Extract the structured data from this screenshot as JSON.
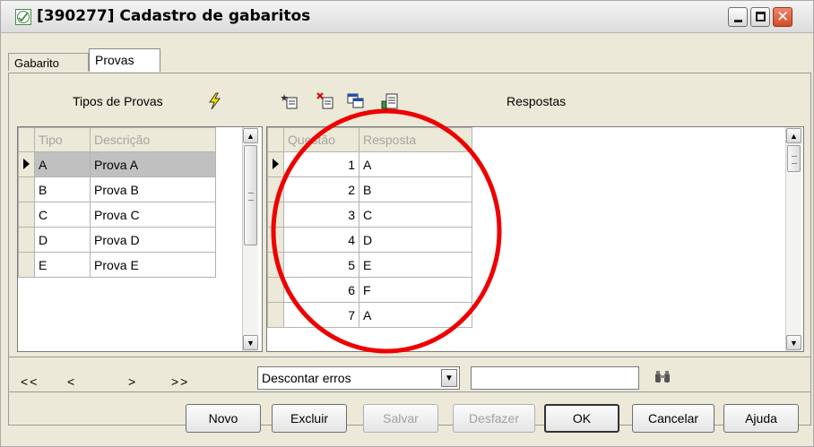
{
  "window": {
    "title": "[390277]  Cadastro de gabaritos",
    "icon": "checkmark-app-icon",
    "controls": [
      "minimize-icon",
      "maximize-icon",
      "close-icon"
    ]
  },
  "tabs": [
    {
      "label": "Gabarito",
      "active": false
    },
    {
      "label": "Provas",
      "active": true
    }
  ],
  "left_panel": {
    "heading": "Tipos de Provas",
    "heading_icon": "lightning-icon",
    "columns": [
      "Tipo",
      "Descrição"
    ],
    "rows": [
      {
        "tipo": "A",
        "descricao": "Prova A",
        "selected": true
      },
      {
        "tipo": "B",
        "descricao": "Prova B"
      },
      {
        "tipo": "C",
        "descricao": "Prova C"
      },
      {
        "tipo": "D",
        "descricao": "Prova D"
      },
      {
        "tipo": "E",
        "descricao": "Prova E"
      }
    ]
  },
  "right_panel": {
    "heading": "Respostas",
    "tool_icons": [
      "new-record-icon",
      "delete-record-icon",
      "copy-windows-icon",
      "list-icon"
    ],
    "columns": [
      "Questão",
      "Resposta"
    ],
    "rows": [
      {
        "questao": "1",
        "resposta": "A",
        "current": true
      },
      {
        "questao": "2",
        "resposta": "B"
      },
      {
        "questao": "3",
        "resposta": "C"
      },
      {
        "questao": "4",
        "resposta": "D"
      },
      {
        "questao": "5",
        "resposta": "E"
      },
      {
        "questao": "6",
        "resposta": "F"
      },
      {
        "questao": "7",
        "resposta": "A"
      }
    ]
  },
  "navigation": {
    "first": "<<",
    "prev": "<",
    "next": ">",
    "last": ">>",
    "filter_selected": "Descontar erros",
    "search_value": "",
    "search_icon": "binoculars-icon"
  },
  "buttons": {
    "novo": "Novo",
    "excluir": "Excluir",
    "salvar": "Salvar",
    "desfazer": "Desfazer",
    "ok": "OK",
    "cancelar": "Cancelar",
    "ajuda": "Ajuda"
  },
  "annotation": {
    "shape": "circle",
    "color": "#ee0000"
  }
}
